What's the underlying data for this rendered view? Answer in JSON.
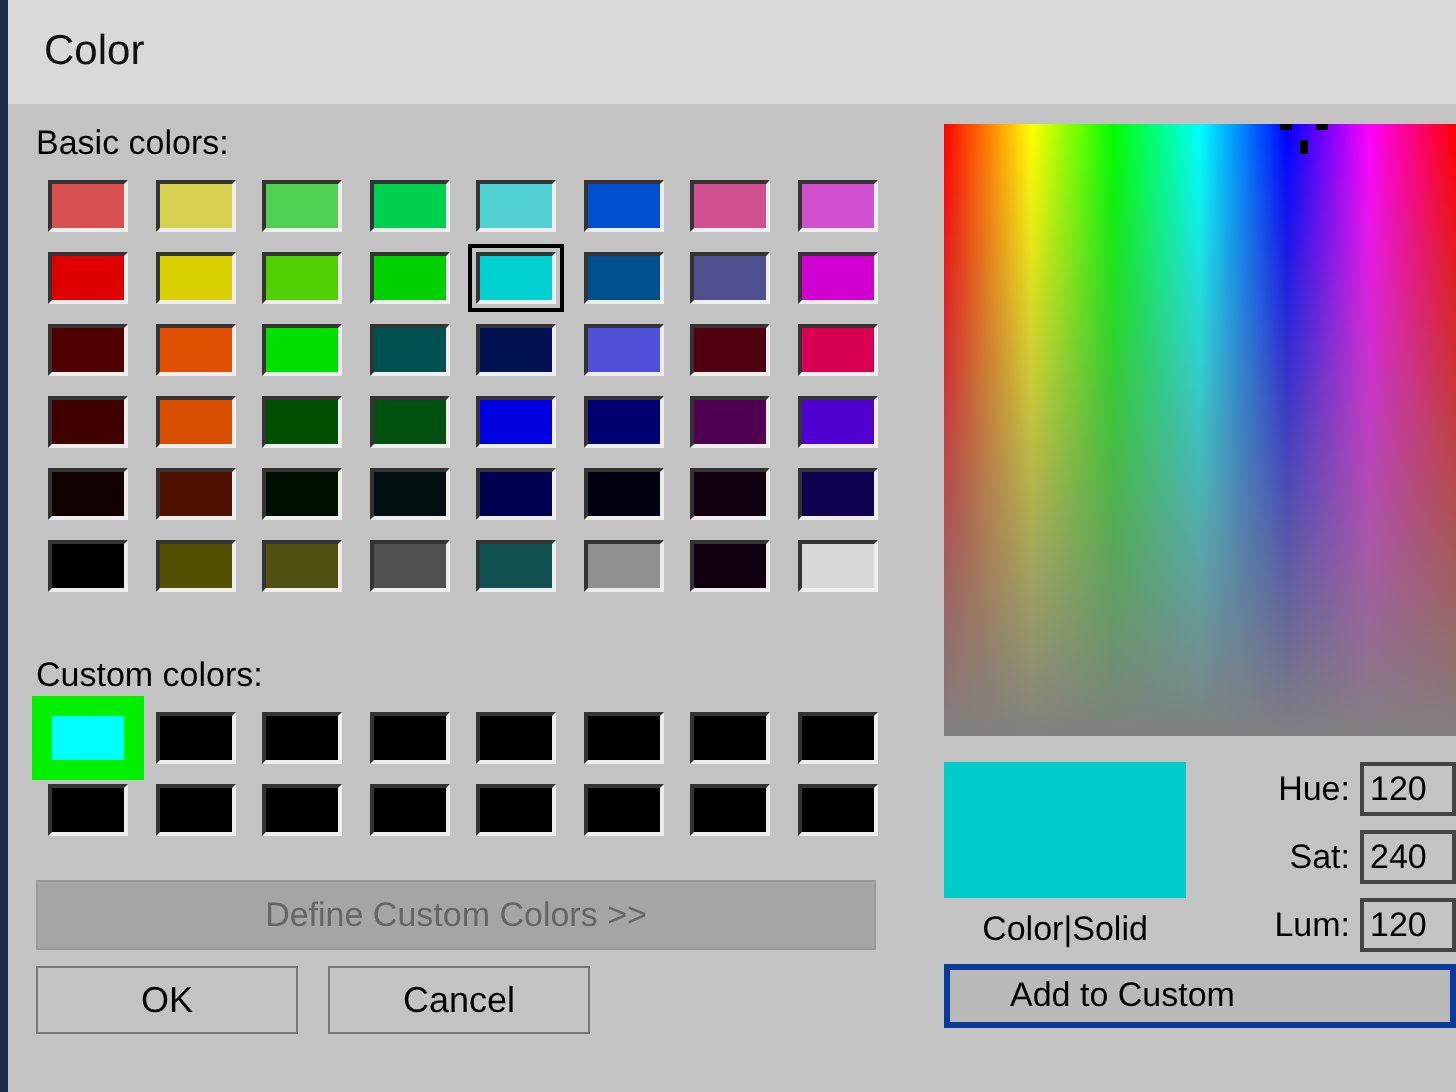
{
  "window": {
    "title": "Color"
  },
  "basic_colors": {
    "label": "Basic colors:",
    "swatches": [
      {
        "color": "#d85050",
        "selected": false
      },
      {
        "color": "#d8d050",
        "selected": false
      },
      {
        "color": "#50d050",
        "selected": false
      },
      {
        "color": "#00d050",
        "selected": false
      },
      {
        "color": "#50d0d0",
        "selected": false
      },
      {
        "color": "#0050d0",
        "selected": false
      },
      {
        "color": "#d05090",
        "selected": false
      },
      {
        "color": "#d050d0",
        "selected": false
      },
      {
        "color": "#e00000",
        "selected": false
      },
      {
        "color": "#d8d000",
        "selected": false
      },
      {
        "color": "#50d000",
        "selected": false
      },
      {
        "color": "#00d000",
        "selected": false
      },
      {
        "color": "#00d0d0",
        "selected": true
      },
      {
        "color": "#005090",
        "selected": false
      },
      {
        "color": "#505090",
        "selected": false
      },
      {
        "color": "#d000d0",
        "selected": false
      },
      {
        "color": "#500000",
        "selected": false
      },
      {
        "color": "#e05000",
        "selected": false
      },
      {
        "color": "#00e000",
        "selected": false
      },
      {
        "color": "#005050",
        "selected": false
      },
      {
        "color": "#001050",
        "selected": false
      },
      {
        "color": "#5050d8",
        "selected": false
      },
      {
        "color": "#500010",
        "selected": false
      },
      {
        "color": "#d80050",
        "selected": false
      },
      {
        "color": "#400000",
        "selected": false
      },
      {
        "color": "#d85000",
        "selected": false
      },
      {
        "color": "#005000",
        "selected": false
      },
      {
        "color": "#005010",
        "selected": false
      },
      {
        "color": "#0000e0",
        "selected": false
      },
      {
        "color": "#000070",
        "selected": false
      },
      {
        "color": "#500050",
        "selected": false
      },
      {
        "color": "#5000d0",
        "selected": false
      },
      {
        "color": "#100000",
        "selected": false
      },
      {
        "color": "#501000",
        "selected": false
      },
      {
        "color": "#001000",
        "selected": false
      },
      {
        "color": "#001010",
        "selected": false
      },
      {
        "color": "#000050",
        "selected": false
      },
      {
        "color": "#000010",
        "selected": false
      },
      {
        "color": "#100010",
        "selected": false
      },
      {
        "color": "#100050",
        "selected": false
      },
      {
        "color": "#000000",
        "selected": false
      },
      {
        "color": "#505000",
        "selected": false
      },
      {
        "color": "#505010",
        "selected": false
      },
      {
        "color": "#505050",
        "selected": false
      },
      {
        "color": "#105050",
        "selected": false
      },
      {
        "color": "#909090",
        "selected": false
      },
      {
        "color": "#100010",
        "selected": false
      },
      {
        "color": "#d8d8d8",
        "selected": false
      }
    ]
  },
  "custom_colors": {
    "label": "Custom colors:",
    "swatches": [
      {
        "color": "#00ffff",
        "selected": true
      },
      {
        "color": "#000000",
        "selected": false
      },
      {
        "color": "#000000",
        "selected": false
      },
      {
        "color": "#000000",
        "selected": false
      },
      {
        "color": "#000000",
        "selected": false
      },
      {
        "color": "#000000",
        "selected": false
      },
      {
        "color": "#000000",
        "selected": false
      },
      {
        "color": "#000000",
        "selected": false
      },
      {
        "color": "#000000",
        "selected": false
      },
      {
        "color": "#000000",
        "selected": false
      },
      {
        "color": "#000000",
        "selected": false
      },
      {
        "color": "#000000",
        "selected": false
      },
      {
        "color": "#000000",
        "selected": false
      },
      {
        "color": "#000000",
        "selected": false
      },
      {
        "color": "#000000",
        "selected": false
      },
      {
        "color": "#000000",
        "selected": false
      }
    ]
  },
  "define_button": {
    "label": "Define Custom Colors >>",
    "disabled": true
  },
  "buttons": [
    {
      "label": "OK"
    },
    {
      "label": "Cancel"
    }
  ],
  "preview": {
    "color": "#00cccc",
    "label": "Color|Solid"
  },
  "fields": [
    {
      "label": "Hue:",
      "value": "120"
    },
    {
      "label": "Sat:",
      "value": "240"
    },
    {
      "label": "Lum:",
      "value": "120"
    }
  ],
  "add_button": {
    "label": "Add to Custom"
  }
}
